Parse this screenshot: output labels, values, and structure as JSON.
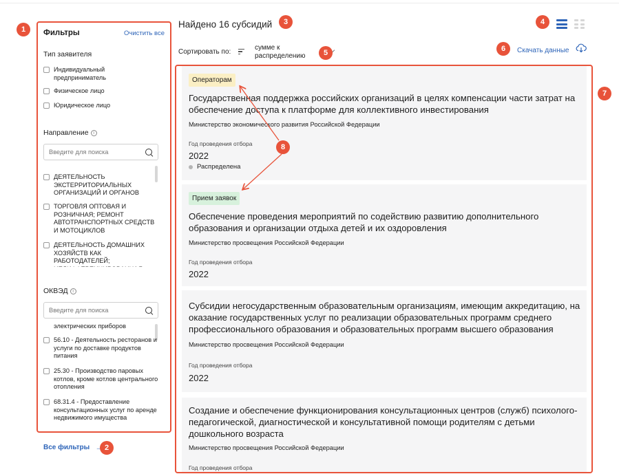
{
  "sidebar": {
    "title": "Фильтры",
    "clear_all": "Очистить все",
    "applicant": {
      "title": "Тип заявителя",
      "options": [
        "Индивидуальный предприниматель",
        "Физическое лицо",
        "Юридическое лицо"
      ]
    },
    "direction": {
      "title": "Направление",
      "search_placeholder": "Введите для поиска",
      "options": [
        "ДЕЯТЕЛЬНОСТЬ ЭКСТЕРРИТОРИАЛЬНЫХ ОРГАНИЗАЦИЙ И ОРГАНОВ",
        "ТОРГОВЛЯ ОПТОВАЯ И РОЗНИЧНАЯ; РЕМОНТ АВТОТРАНСПОРТНЫХ СРЕДСТВ И МОТОЦИКЛОВ",
        "ДЕЯТЕЛЬНОСТЬ ДОМАШНИХ ХОЗЯЙСТВ КАК РАБОТОДАТЕЛЕЙ; НЕДИФФЕРЕНЦИРОВАННАЯ"
      ]
    },
    "okved": {
      "title": "ОКВЭД",
      "search_placeholder": "Введите для поиска",
      "partial": "электрических приборов",
      "options": [
        "56.10 - Деятельность ресторанов и услуги по доставке продуктов питания",
        "25.30 - Производство паровых котлов, кроме котлов центрального отопления",
        "68.31.4 - Предоставление консультационных услуг по аренде недвижимого имущества"
      ]
    },
    "all_filters": "Все фильтры"
  },
  "header": {
    "found": "Найдено 16 субсидий",
    "sort_label": "Сортировать по:",
    "sort_value": "сумме к распределению",
    "download": "Скачать данные"
  },
  "cards": [
    {
      "badge": "Операторам",
      "title": "Государственная поддержка российских организаций в целях компенсации части затрат на обеспечение доступа к платформе для коллективного инвестирования",
      "ministry": "Министерство экономического развития Российской Федерации",
      "year_label": "Год проведения отбора",
      "year": "2022",
      "status": "Распределена"
    },
    {
      "badge": "Прием заявок",
      "title": "Обеспечение проведения мероприятий по содействию развитию дополнительного образования и организации отдыха детей и их оздоровления",
      "ministry": "Министерство просвещения Российской Федерации",
      "year_label": "Год проведения отбора",
      "year": "2022"
    },
    {
      "title": "Субсидии негосударственным образовательным организациям, имеющим аккредитацию, на оказание государственных услуг по реализации образовательных программ среднего профессионального образования и образовательных программ высшего образования",
      "ministry": "Министерство просвещения Российской Федерации",
      "year_label": "Год проведения отбора",
      "year": "2022"
    },
    {
      "title": "Создание и обеспечение функционирования консультационных центров (служб) психолого-педагогической, диагностической и консультативной помощи родителям с детьми дошкольного возраста",
      "ministry": "Министерство просвещения Российской Федерации",
      "year_label": "Год проведения отбора"
    }
  ],
  "markers": [
    "1",
    "2",
    "3",
    "4",
    "5",
    "6",
    "7",
    "8"
  ],
  "colors": {
    "accent": "#2d64b8",
    "annotation": "#e8533a",
    "badge_operators": "#fbefc4",
    "badge_accepting": "#d7f1dc",
    "card_bg": "#f5f5f6"
  }
}
